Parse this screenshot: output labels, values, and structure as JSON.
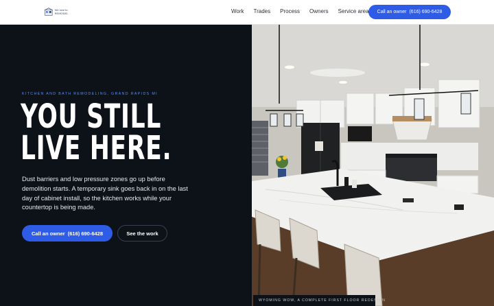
{
  "brand": {
    "logo_text": "We love to REMODEL"
  },
  "nav": {
    "items": [
      "Work",
      "Trades",
      "Process",
      "Owners",
      "Service area"
    ]
  },
  "header_cta": {
    "label": "Call an owner",
    "phone": "(616) 690-6428"
  },
  "hero": {
    "eyebrow": "KITCHEN AND BATH REMODELING, GRAND RAPIDS MI",
    "headline_line1": "YOU STILL",
    "headline_line2": "LIVE HERE.",
    "lead": "Dust barriers and low pressure zones go up before demolition starts. A temporary sink goes back in on the last day of cabinet install, so the kitchen works while your countertop is being made.",
    "primary_cta": {
      "label": "Call an owner",
      "phone": "(616) 690-6428"
    },
    "secondary_cta": "See the work"
  },
  "photo": {
    "caption": "WYOMING WOW, A COMPLETE FIRST FLOOR REDESIGN"
  },
  "colors": {
    "accent": "#2e5ce6",
    "dark_bg": "#0d1219",
    "eyebrow": "#5b8cf0"
  }
}
